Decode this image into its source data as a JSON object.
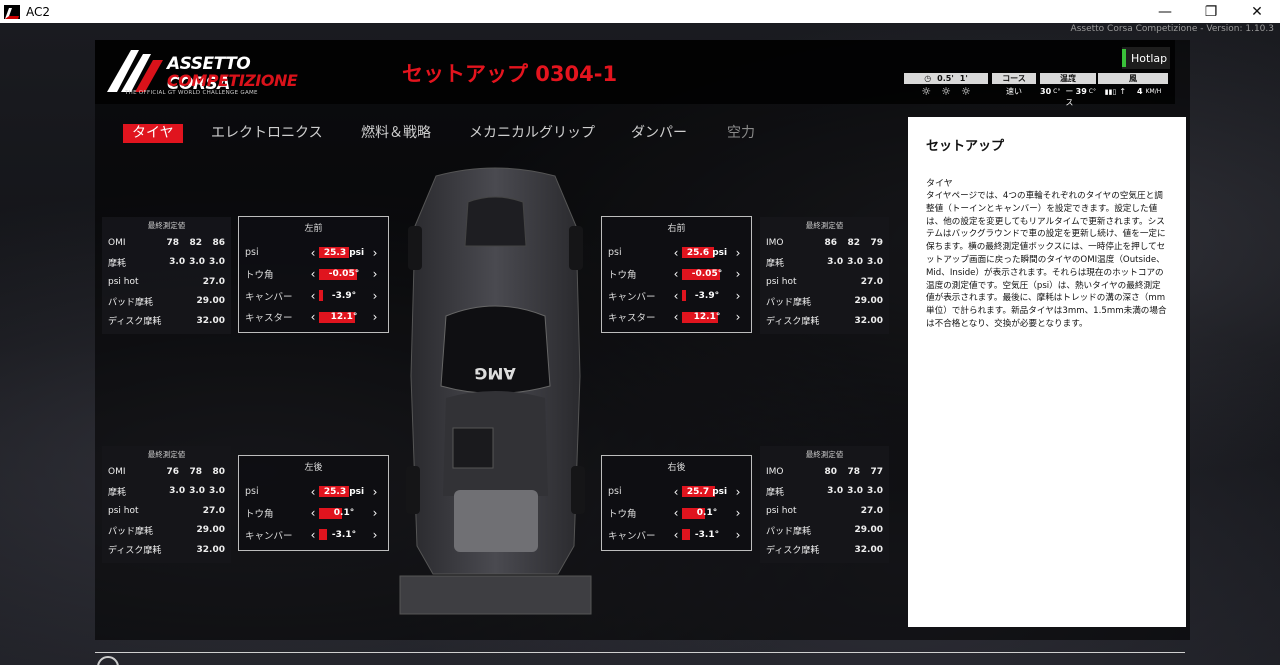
{
  "window": {
    "title": "AC2",
    "minimize": "—",
    "maximize": "❐",
    "close": "✕"
  },
  "version": "Assetto Corsa Competizione - Version: 1.10.3",
  "logo": {
    "line1": "ASSETTO CORSA",
    "line2": "COMPETIZIONE",
    "tagline": "THE OFFICIAL GT WORLD CHALLENGE GAME"
  },
  "setup_title": "セットアップ 0304-1",
  "session": {
    "label": "Hotlap",
    "indicator_color": "#3ac13a"
  },
  "weather": {
    "time": {
      "a": "0.5'",
      "b": "1'"
    },
    "course": {
      "header": "コース",
      "value": "速い"
    },
    "temp": {
      "header": "温度",
      "air": "30",
      "air_unit": "C°",
      "track_label": "コース",
      "track": "39",
      "track_unit": "C°"
    },
    "wind": {
      "header": "風",
      "value": "4",
      "unit": "KM/H"
    }
  },
  "tabs": [
    {
      "label": "タイヤ"
    },
    {
      "label": "エレクトロニクス"
    },
    {
      "label": "燃料＆戦略"
    },
    {
      "label": "メカニカルグリップ"
    },
    {
      "label": "ダンパー"
    },
    {
      "label": "空力"
    }
  ],
  "accent_color": "#e0141e",
  "stats_header": "最終測定値",
  "stat_labels": {
    "temps_left": "OMI",
    "temps_right": "IMO",
    "wear": "摩耗",
    "psi_hot": "psi hot",
    "pad": "パッド摩耗",
    "disc": "ディスク摩耗"
  },
  "stats": {
    "fl": {
      "temps": [
        "78",
        "82",
        "86"
      ],
      "wear": [
        "3.0",
        "3.0",
        "3.0"
      ],
      "psi_hot": "27.0",
      "pad": "29.00",
      "disc": "32.00"
    },
    "fr": {
      "temps": [
        "86",
        "82",
        "79"
      ],
      "wear": [
        "3.0",
        "3.0",
        "3.0"
      ],
      "psi_hot": "27.0",
      "pad": "29.00",
      "disc": "32.00"
    },
    "rl": {
      "temps": [
        "76",
        "78",
        "80"
      ],
      "wear": [
        "3.0",
        "3.0",
        "3.0"
      ],
      "psi_hot": "27.0",
      "pad": "29.00",
      "disc": "32.00"
    },
    "rr": {
      "temps": [
        "80",
        "78",
        "77"
      ],
      "wear": [
        "3.0",
        "3.0",
        "3.0"
      ],
      "psi_hot": "27.0",
      "pad": "29.00",
      "disc": "32.00"
    }
  },
  "tire_labels": {
    "psi": "psi",
    "toe": "トウ角",
    "camber": "キャンバー",
    "caster": "キャスター"
  },
  "tires": {
    "fl": {
      "title": "左前",
      "psi": "25.3 psi",
      "psi_fill": 0.6,
      "toe": "-0.05°",
      "toe_fill": 0.75,
      "camber": "-3.9°",
      "camber_fill": 0.08,
      "caster": "12.1°",
      "caster_fill": 0.72
    },
    "fr": {
      "title": "右前",
      "psi": "25.6 psi",
      "psi_fill": 0.64,
      "toe": "-0.05°",
      "toe_fill": 0.75,
      "camber": "-3.9°",
      "camber_fill": 0.08,
      "caster": "12.1°",
      "caster_fill": 0.72
    },
    "rl": {
      "title": "左後",
      "psi": "25.3 psi",
      "psi_fill": 0.6,
      "toe": "0.1°",
      "toe_fill": 0.45,
      "camber": "-3.1°",
      "camber_fill": 0.16
    },
    "rr": {
      "title": "右後",
      "psi": "25.7 psi",
      "psi_fill": 0.65,
      "toe": "0.1°",
      "toe_fill": 0.45,
      "camber": "-3.1°",
      "camber_fill": 0.16
    }
  },
  "car_badge": "AMG",
  "description": {
    "title": "セットアップ",
    "subtitle": "タイヤ",
    "body": "タイヤページでは、4つの車輪それぞれのタイヤの空気圧と調整値（トーインとキャンバー）を設定できます。設定した値は、他の設定を変更してもリアルタイムで更新されます。システムはバックグラウンドで車の設定を更新し続け、値を一定に保ちます。横の最終測定値ボックスには、一時停止を押してセットアップ画面に戻った瞬間のタイヤのOMI温度（Outside、Mid、Inside）が表示されます。それらは現在のホットコアの温度の測定値です。空気圧（psi）は、熱いタイヤの最終測定値が表示されます。最後に、摩耗はトレッドの溝の深さ（mm単位）で計られます。新品タイヤは3mm、1.5mm未満の場合は不合格となり、交換が必要となります。"
  }
}
